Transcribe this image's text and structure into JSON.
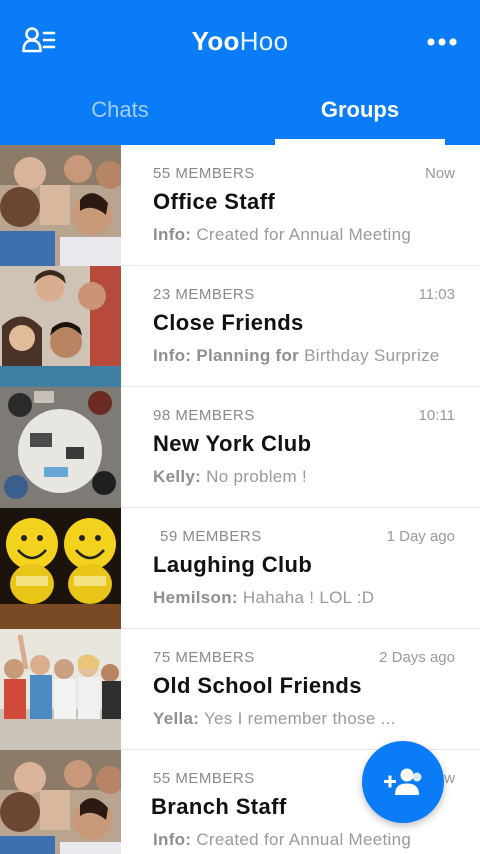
{
  "header": {
    "title_bold": "Yoo",
    "title_light": "Hoo",
    "profile_icon": "contacts-list-icon",
    "menu_icon": "more-horizontal-icon"
  },
  "tabs": [
    {
      "label": "Chats",
      "active": false
    },
    {
      "label": "Groups",
      "active": true
    }
  ],
  "groups": [
    {
      "members": "55 MEMBERS",
      "time": "Now",
      "name": "Office Staff",
      "sender": "Info:",
      "message": "Created for Annual Meeting"
    },
    {
      "members": "23 MEMBERS",
      "time": "11:03",
      "name": "Close Friends",
      "sender": "Info: Planning for",
      "message": "Birthday Surprize"
    },
    {
      "members": "98 MEMBERS",
      "time": "10:11",
      "name": "New York Club",
      "sender": "Kelly:",
      "message": "No problem !"
    },
    {
      "members": "59 MEMBERS",
      "time": "1 Day ago",
      "name": "Laughing Club",
      "sender": "Hemilson:",
      "message": "Hahaha ! LOL :D"
    },
    {
      "members": "75 MEMBERS",
      "time": "2 Days ago",
      "name": "Old School Friends",
      "sender": "Yella:",
      "message": "Yes I remember those ..."
    },
    {
      "members": "55 MEMBERS",
      "time": "Now",
      "name": "Branch Staff",
      "sender": "Info:",
      "message": "Created for Annual Meeting"
    }
  ],
  "fab": {
    "icon": "add-group-icon"
  },
  "colors": {
    "primary": "#0a7cf7",
    "text": "#111111",
    "muted": "#9a9a9a"
  }
}
